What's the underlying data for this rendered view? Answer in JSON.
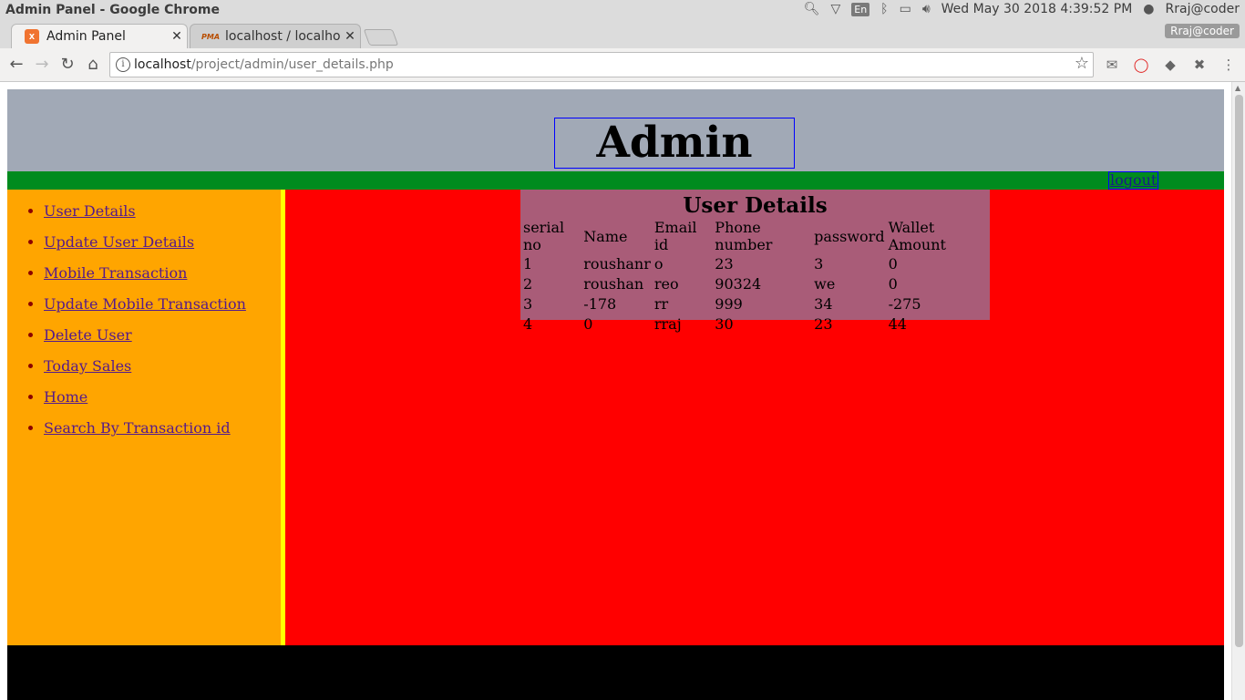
{
  "os": {
    "window_title": "Admin Panel - Google Chrome",
    "keyboard": "En",
    "datetime": "Wed May 30 2018  4:39:52 PM",
    "user": "Rraj@coder"
  },
  "browser": {
    "tabs": [
      {
        "label": "Admin Panel",
        "favicon": "xampp-icon",
        "favicon_text": "X"
      },
      {
        "label": "localhost / localhos",
        "favicon": "phpmyadmin-icon",
        "favicon_text": "PMA"
      }
    ],
    "profile": "Rraj@coder",
    "url_host": "localhost",
    "url_path": "/project/admin/user_details.php"
  },
  "page": {
    "title": "Admin Panel",
    "logout": "logout",
    "sidebar": [
      "User Details",
      "Update User Details",
      "Mobile Transaction",
      "Update Mobile Transaction",
      "Delete User",
      "Today Sales",
      "Home",
      "Search By Transaction id"
    ],
    "details": {
      "heading": "User Details",
      "columns": [
        "serial no",
        "Name",
        "Email id",
        "Phone number",
        "password",
        "Wallet Amount"
      ],
      "rows": [
        [
          "1",
          "roushanr",
          "o",
          "23",
          "3",
          "0"
        ],
        [
          "2",
          "roushan",
          "reo",
          "90324",
          "we",
          "0"
        ],
        [
          "3",
          "-178",
          "rr",
          "999",
          "34",
          "-275"
        ],
        [
          "4",
          "0",
          "rraj",
          "30",
          "23",
          "44"
        ]
      ]
    }
  },
  "colors": {
    "header": "#a1a9b6",
    "navbar": "#008b1e",
    "sidebar": "#ffa500",
    "main": "#ff0000",
    "details": "#a95c78",
    "footer": "#000000"
  }
}
